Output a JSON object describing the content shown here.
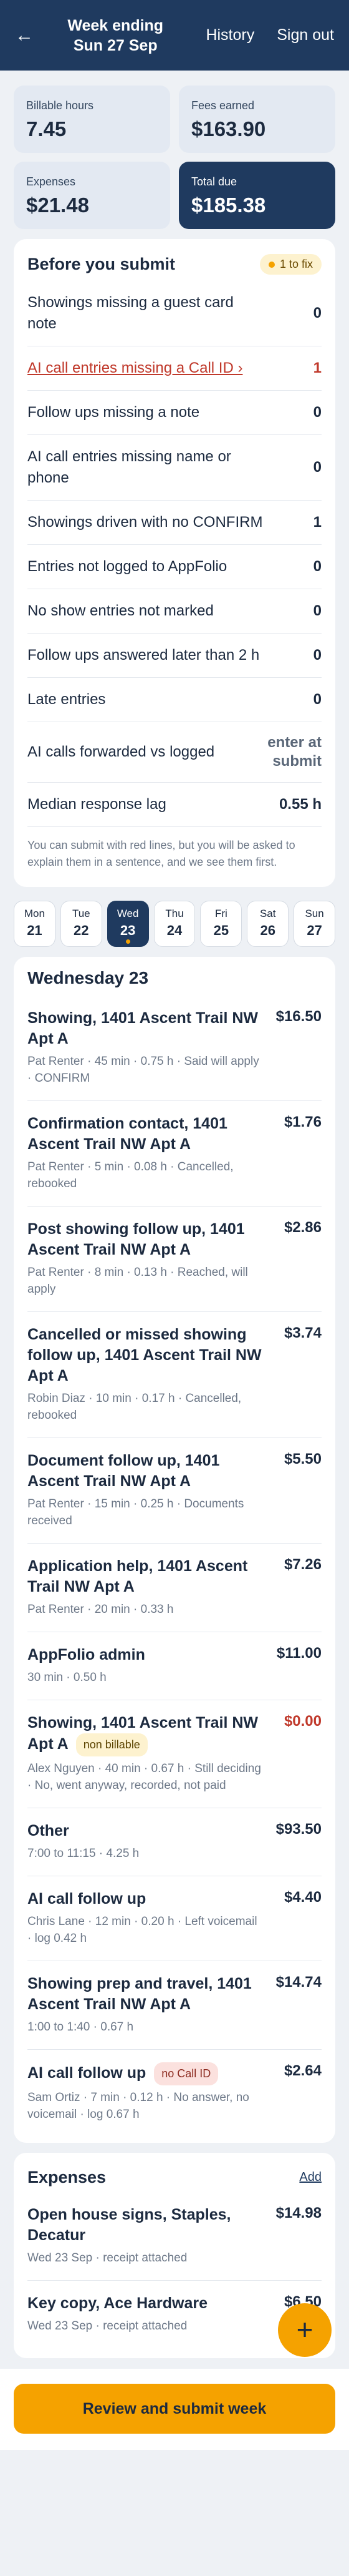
{
  "header": {
    "back_icon": "←",
    "title_line1": "Week ending",
    "title_line2": "Sun 27 Sep",
    "history": "History",
    "sign_out": "Sign out"
  },
  "stats": [
    {
      "label": "Billable hours",
      "value": "7.45"
    },
    {
      "label": "Fees earned",
      "value": "$163.90"
    },
    {
      "label": "Expenses",
      "value": "$21.48"
    },
    {
      "label": "Total due",
      "value": "$185.38"
    }
  ],
  "checks": {
    "title": "Before you submit",
    "badge": "1 to fix",
    "rows": [
      {
        "label": "Showings missing a guest card note",
        "value": "0"
      },
      {
        "label": "AI call entries missing a Call ID ›",
        "value": "1",
        "flag": true
      },
      {
        "label": "Follow ups missing a note",
        "value": "0"
      },
      {
        "label": "AI call entries missing name or phone",
        "value": "0"
      },
      {
        "label": "Showings driven with no CONFIRM",
        "value": "1"
      },
      {
        "label": "Entries not logged to AppFolio",
        "value": "0"
      },
      {
        "label": "No show entries not marked",
        "value": "0"
      },
      {
        "label": "Follow ups answered later than 2 h",
        "value": "0"
      },
      {
        "label": "Late entries",
        "value": "0"
      },
      {
        "label": "AI calls forwarded vs logged",
        "value": "enter at submit"
      },
      {
        "label": "Median response lag",
        "value": "0.55 h"
      }
    ],
    "note": "You can submit with red lines, but you will be asked to explain them in a sentence, and we see them first."
  },
  "days": [
    {
      "name": "Mon",
      "date": "21"
    },
    {
      "name": "Tue",
      "date": "22"
    },
    {
      "name": "Wed",
      "date": "23"
    },
    {
      "name": "Thu",
      "date": "24"
    },
    {
      "name": "Fri",
      "date": "25"
    },
    {
      "name": "Sat",
      "date": "26"
    },
    {
      "name": "Sun",
      "date": "27"
    }
  ],
  "selected_day": "Wednesday 23",
  "entries": [
    {
      "title": "Showing, 1401 Ascent Trail NW Apt A",
      "sub": "Pat Renter · 45 min · 0.75 h · Said will apply · CONFIRM",
      "amount": "$16.50"
    },
    {
      "title": "Confirmation contact, 1401 Ascent Trail NW Apt A",
      "sub": "Pat Renter · 5 min · 0.08 h · Cancelled, rebooked",
      "amount": "$1.76"
    },
    {
      "title": "Post showing follow up, 1401 Ascent Trail NW Apt A",
      "sub": "Pat Renter · 8 min · 0.13 h · Reached, will apply",
      "amount": "$2.86"
    },
    {
      "title": "Cancelled or missed showing follow up, 1401 Ascent Trail NW Apt A",
      "sub": "Robin Diaz · 10 min · 0.17 h · Cancelled, rebooked",
      "amount": "$3.74"
    },
    {
      "title": "Document follow up, 1401 Ascent Trail NW Apt A",
      "sub": "Pat Renter · 15 min · 0.25 h · Documents received",
      "amount": "$5.50"
    },
    {
      "title": "Application help, 1401 Ascent Trail NW Apt A",
      "sub": "Pat Renter · 20 min · 0.33 h",
      "amount": "$7.26"
    },
    {
      "title": "AppFolio admin",
      "sub": "30 min · 0.50 h",
      "amount": "$11.00"
    },
    {
      "title": "Showing, 1401 Ascent Trail NW Apt A",
      "tag": "non billable",
      "sub": "Alex Nguyen · 40 min · 0.67 h · Still deciding · No, went anyway, recorded, not paid",
      "amount": "$0.00"
    },
    {
      "title": "Other",
      "sub": "7:00 to 11:15 · 4.25 h",
      "amount": "$93.50"
    },
    {
      "title": "AI call follow up",
      "sub": "Chris Lane · 12 min · 0.20 h · Left voicemail · log 0.42 h",
      "amount": "$4.40"
    },
    {
      "title": "Showing prep and travel, 1401 Ascent Trail NW Apt A",
      "sub": "1:00 to 1:40 · 0.67 h",
      "amount": "$14.74"
    },
    {
      "title": "AI call follow up",
      "tag": "no Call ID",
      "sub": "Sam Ortiz · 7 min · 0.12 h · No answer, no voicemail · log 0.67 h",
      "amount": "$2.64"
    }
  ],
  "expenses": {
    "title": "Expenses",
    "add": "Add",
    "items": [
      {
        "title": "Open house signs, Staples, Decatur",
        "sub": "Wed 23 Sep · receipt attached",
        "amount": "$14.98"
      },
      {
        "title": "Key copy, Ace Hardware",
        "sub": "Wed 23 Sep · receipt attached",
        "amount": "$6.50"
      }
    ]
  },
  "fab": "+",
  "submit": "Review and submit week"
}
